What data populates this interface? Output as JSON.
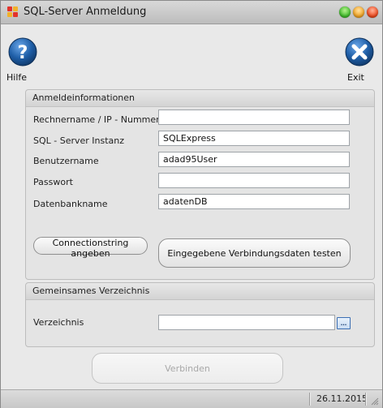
{
  "window": {
    "title": "SQL-Server Anmeldung",
    "app_icon": "app-icon",
    "controls": [
      "minimize-button",
      "maximize-button",
      "close-button"
    ],
    "colors": {
      "minimize": "#3fbf2b",
      "maximize": "#f5a623",
      "close": "#f24a1e"
    }
  },
  "toolbar": {
    "help_label": "Hilfe",
    "help_icon": "help-icon",
    "exit_label": "Exit",
    "exit_icon": "exit-icon",
    "accent": "#1f5fa8"
  },
  "login_section": {
    "header": "Anmeldeinformationen",
    "fields": [
      {
        "label": "Rechnername / IP - Nummer",
        "value": ""
      },
      {
        "label": "SQL - Server Instanz",
        "value": "SQLExpress"
      },
      {
        "label": "Benutzername",
        "value": "adad95User"
      },
      {
        "label": "Passwort",
        "value": ""
      },
      {
        "label": "Datenbankname",
        "value": "adatenDB"
      }
    ],
    "connectionstring_button": "Connectionstring angeben",
    "test_button": "Eingegebene Verbindungsdaten testen"
  },
  "directory_section": {
    "header": "Gemeinsames Verzeichnis",
    "label": "Verzeichnis",
    "value": "",
    "browse_button": "..."
  },
  "connect_button": "Verbinden",
  "status": {
    "date": "26.11.2015"
  }
}
